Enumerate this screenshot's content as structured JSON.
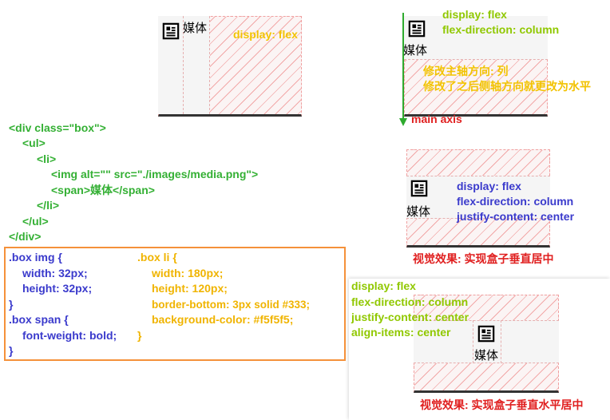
{
  "media_label": "媒体",
  "example1": {
    "note": "display: flex"
  },
  "example2": {
    "note_line1": "display: flex",
    "note_line2": "flex-direction: column",
    "explain_line1": "修改主轴方向: 列",
    "explain_line2": "修改了之后侧轴方向就更改为水平",
    "axis_label": "main axis"
  },
  "example3": {
    "note_line1": "display: flex",
    "note_line2": "flex-direction: column",
    "note_line3": "justify-content: center",
    "caption": "视觉效果: 实现盒子垂直居中"
  },
  "example4": {
    "note_line1": "display: flex",
    "note_line2": "flex-direction: column",
    "note_line3": "justify-content: center",
    "note_line4": "align-items: center",
    "caption": "视觉效果: 实现盒子垂直水平居中"
  },
  "html_code": [
    "<div class=\"box\">",
    "<ul>",
    "<li>",
    "<img alt=\"\" src=\"./images/media.png\">",
    "<span>媒体</span>",
    "</li>",
    "</ul>",
    "</div>"
  ],
  "css_left": [
    ".box img {",
    "width: 32px;",
    "height: 32px;",
    "}",
    ".box span {",
    "font-weight: bold;",
    "}"
  ],
  "css_right": [
    ".box li {",
    "width: 180px;",
    "height: 120px;",
    "border-bottom: 3px solid #333;",
    "background-color: #f5f5f5;",
    "}"
  ],
  "colors": {
    "note_yellow": "#f2c200",
    "note_green": "#90c800",
    "note_blue": "#3a3acc",
    "caption_red": "#e02020",
    "axis_green": "#2eaa2e",
    "code_green": "#34b034",
    "css_border": "#f5913a"
  },
  "icons": [
    "media-icon"
  ]
}
